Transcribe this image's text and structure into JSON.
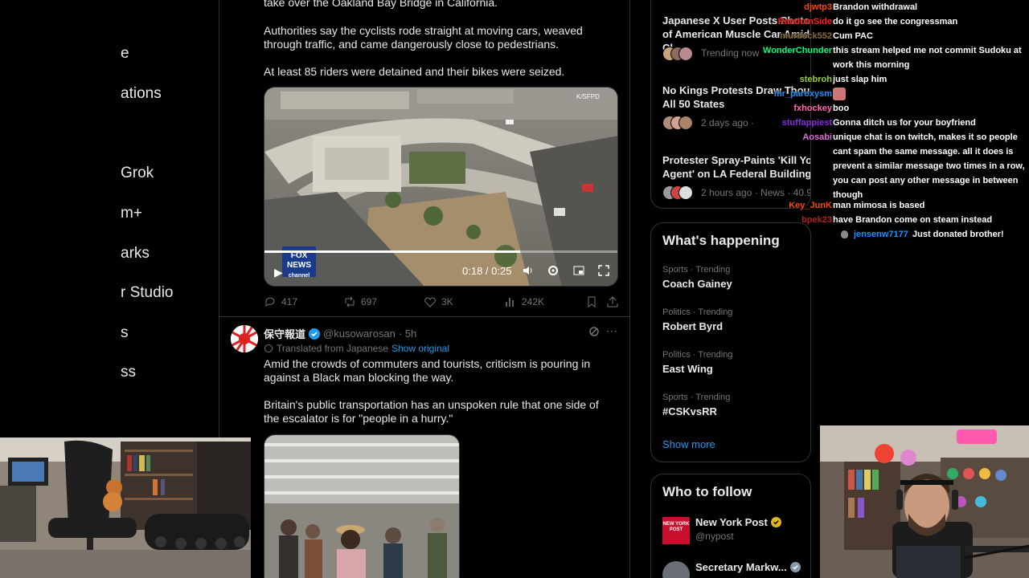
{
  "nav": {
    "items": [
      "e",
      "ations",
      "Grok",
      "m+",
      "arks",
      "r Studio",
      "s",
      "ss"
    ]
  },
  "tweet1": {
    "text_top": "take over the Oakland Bay Bridge in California.",
    "text_p2": "Authorities say the cyclists rode straight at moving cars, weaved through traffic, and came dangerously close to pedestrians.",
    "text_p3": "At least 85 riders were detained and their bikes were seized.",
    "video_time": "0:18 / 0:25",
    "watermark": "FOX NEWS",
    "watermark_sub": "channel",
    "corner_text": "K/SFPD",
    "replies": "417",
    "reposts": "697",
    "likes": "3K",
    "views": "242K"
  },
  "tweet2": {
    "name": "保守報道",
    "handle": "@kusowarosan",
    "time": "· 5h",
    "translated": "Translated from Japanese",
    "show_original": "Show original",
    "p1": "Amid the crowds of commuters and tourists, criticism is pouring in against a Black man blocking the way.",
    "p2": "Britain's public transportation has an unspoken rule that one side of the escalator is for \"people in a hurry.\""
  },
  "news": [
    {
      "title": "Japanese X User Posts Photo of American Muscle Car Amid Cl",
      "meta": "Trending now"
    },
    {
      "title": "No Kings Protests Draw Thou All 50 States",
      "meta": "2 days ago ·"
    },
    {
      "title": "Protester Spray-Paints 'Kill Yo Agent' on LA Federal Building",
      "meta": "2 hours ago · News · 40.9K"
    }
  ],
  "whats_happening": {
    "heading": "What's happening",
    "trends": [
      {
        "category": "Sports · Trending",
        "name": "Coach Gainey"
      },
      {
        "category": "Politics · Trending",
        "name": "Robert Byrd"
      },
      {
        "category": "Politics · Trending",
        "name": "East Wing"
      },
      {
        "category": "Sports · Trending",
        "name": "#CSKvsRR"
      }
    ],
    "show_more": "Show more"
  },
  "who_to_follow": {
    "heading": "Who to follow",
    "accounts": [
      {
        "name": "New York Post",
        "handle": "@nypost",
        "logo": "NEW YORK POST"
      },
      {
        "name": "Secretary Markw...",
        "handle": ""
      }
    ]
  },
  "chat": [
    {
      "user": "djwtp3",
      "color": "#ff4500",
      "msg": "Brandon withdrawal"
    },
    {
      "user": "RandomSide",
      "color": "#ff2020",
      "msg": "do it go see the congressman"
    },
    {
      "user": "murdock552",
      "color": "#8a6a3a",
      "msg": "Cum PAC"
    },
    {
      "user": "WonderChunder",
      "color": "#00ff7f",
      "msg": "this stream helped me not commit Sudoku at work this morning"
    },
    {
      "user": "stebroh",
      "color": "#9acd32",
      "msg": "just slap him"
    },
    {
      "user": "mr_paroxysm",
      "color": "#1e90ff",
      "msg": ""
    },
    {
      "user": "fxhockey",
      "color": "#ff69b4",
      "msg": "boo"
    },
    {
      "user": "stuffappiest",
      "color": "#8a2be2",
      "msg": "Gonna ditch us for your boyfriend"
    },
    {
      "user": "Aosabi",
      "color": "#da70d6",
      "msg": "unique chat is on twitch, makes it so people cant spam the same message. all it does is prevent a similar message two times in a row, you can post any other message in between though"
    },
    {
      "user": "Key_JunK",
      "color": "#ff4500",
      "msg": "man mimosa is based"
    },
    {
      "user": "bpek23",
      "color": "#b22222",
      "msg": "have Brandon come on steam instead"
    },
    {
      "user": "jensenw7177",
      "color": "#1e90ff",
      "msg": "Just donated brother!"
    }
  ],
  "colors": {
    "accent": "#1d9bf0",
    "muted": "#71767b",
    "border": "#2f3336"
  }
}
